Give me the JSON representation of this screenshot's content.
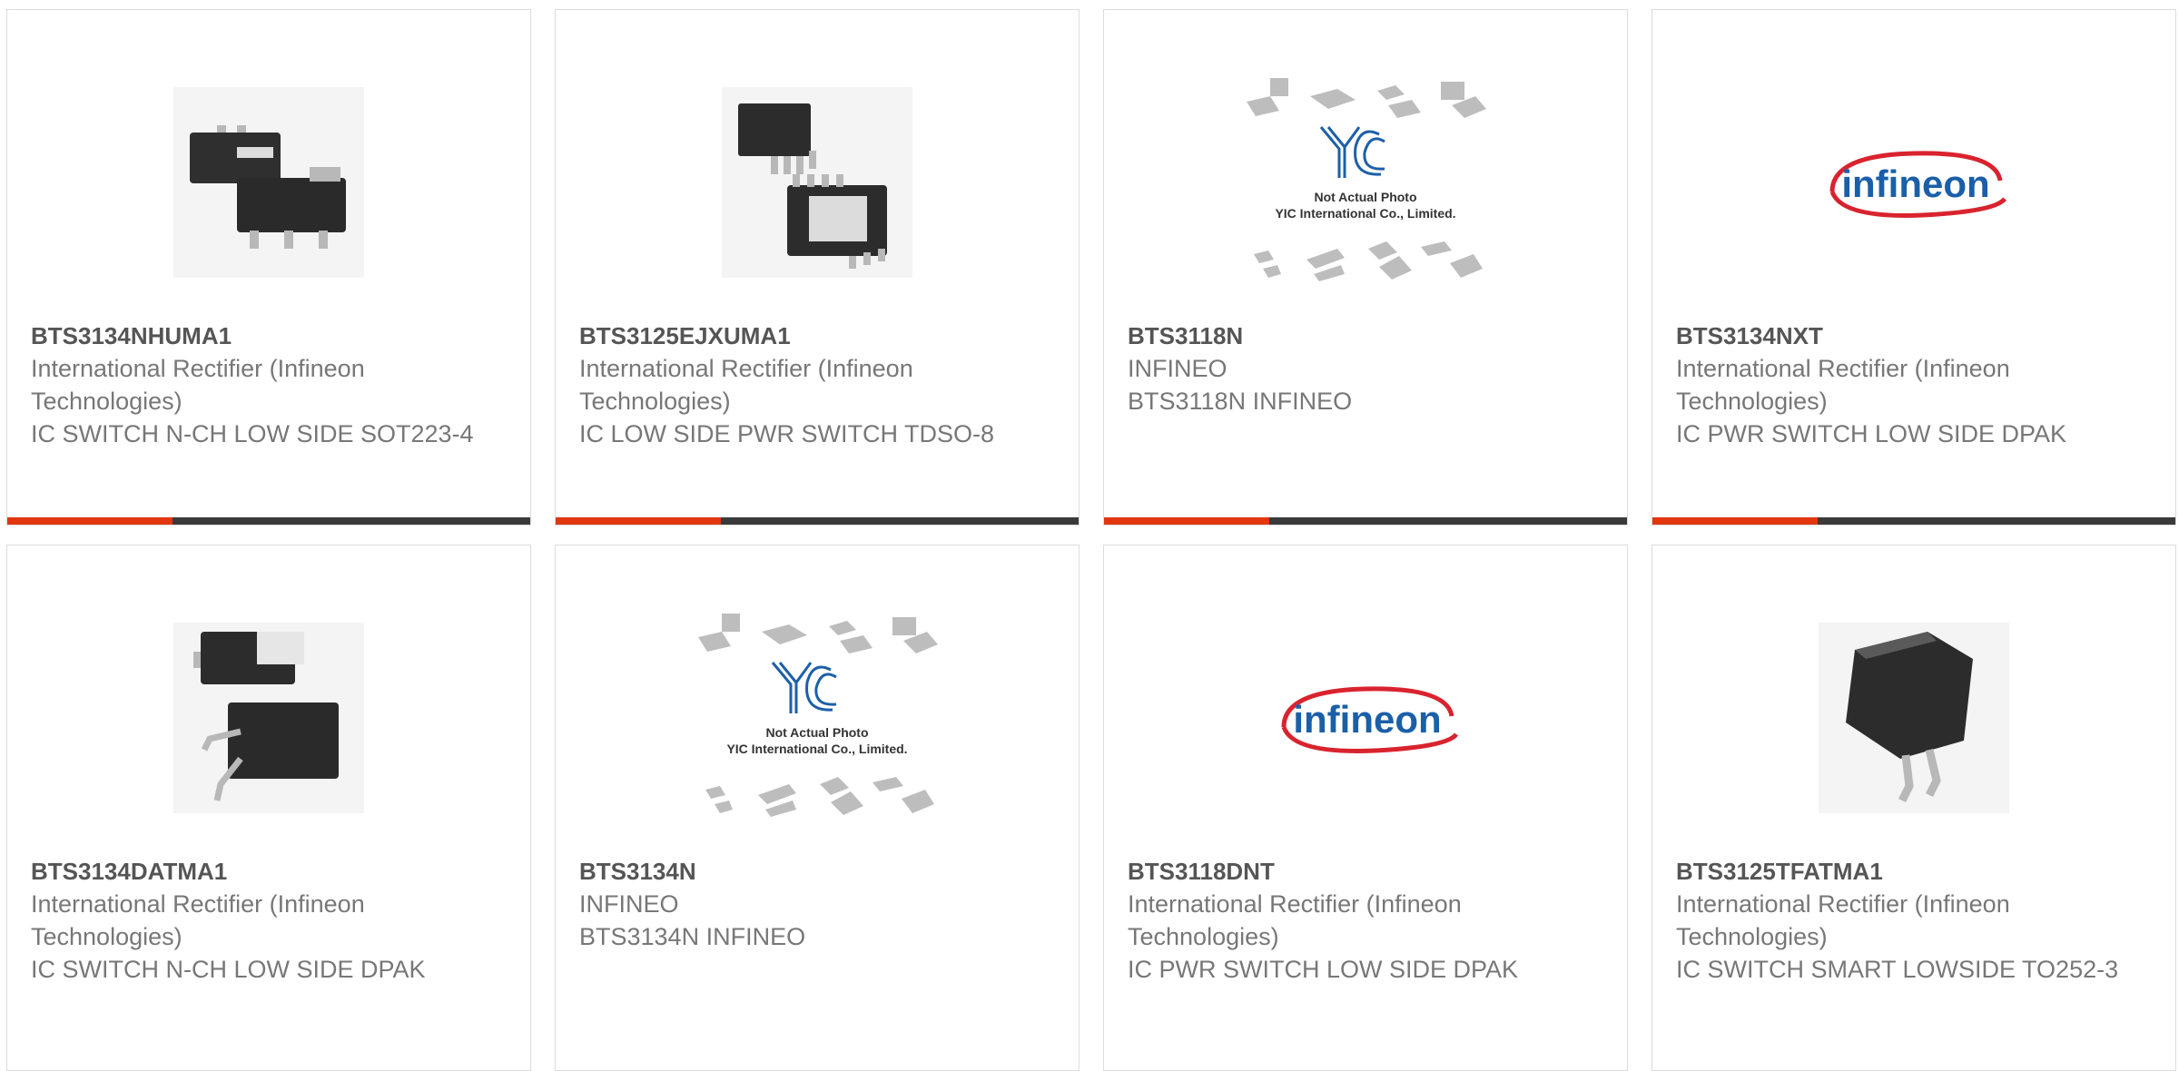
{
  "products": [
    {
      "part": "BTS3134NHUMA1",
      "manufacturer": "International Rectifier (Infineon Technologies)",
      "description": "IC SWITCH N-CH LOW SIDE SOT223-4",
      "image": "sot223-package-photo"
    },
    {
      "part": "BTS3125EJXUMA1",
      "manufacturer": "International Rectifier (Infineon Technologies)",
      "description": "IC LOW SIDE PWR SWITCH TDSO-8",
      "image": "tdso8-package-photo"
    },
    {
      "part": "BTS3118N",
      "manufacturer": "INFINEO",
      "description": "BTS3118N INFINEO",
      "image": "yic-placeholder-photo"
    },
    {
      "part": "BTS3134NXT",
      "manufacturer": "International Rectifier (Infineon Technologies)",
      "description": "IC PWR SWITCH LOW SIDE DPAK",
      "image": "infineon-logo"
    },
    {
      "part": "BTS3134DATMA1",
      "manufacturer": "International Rectifier (Infineon Technologies)",
      "description": "IC SWITCH N-CH LOW SIDE DPAK",
      "image": "dpak-package-photo"
    },
    {
      "part": "BTS3134N",
      "manufacturer": "INFINEO",
      "description": "BTS3134N INFINEO",
      "image": "yic-placeholder-photo"
    },
    {
      "part": "BTS3118DNT",
      "manufacturer": "International Rectifier (Infineon Technologies)",
      "description": "IC PWR SWITCH LOW SIDE DPAK",
      "image": "infineon-logo"
    },
    {
      "part": "BTS3125TFATMA1",
      "manufacturer": "International Rectifier (Infineon Technologies)",
      "description": "IC SWITCH SMART LOWSIDE TO252-3",
      "image": "to252-package-photo"
    }
  ],
  "placeholder_text": {
    "line1": "Not Actual Photo",
    "line2": "YIC International Co., Limited.",
    "logo": "YIC"
  },
  "infineon_logo_text": "infineon",
  "colors": {
    "accent": "#e2360f",
    "bar": "#3a3a3a",
    "brand_blue": "#1a5fa8",
    "brand_red": "#d9232e"
  }
}
